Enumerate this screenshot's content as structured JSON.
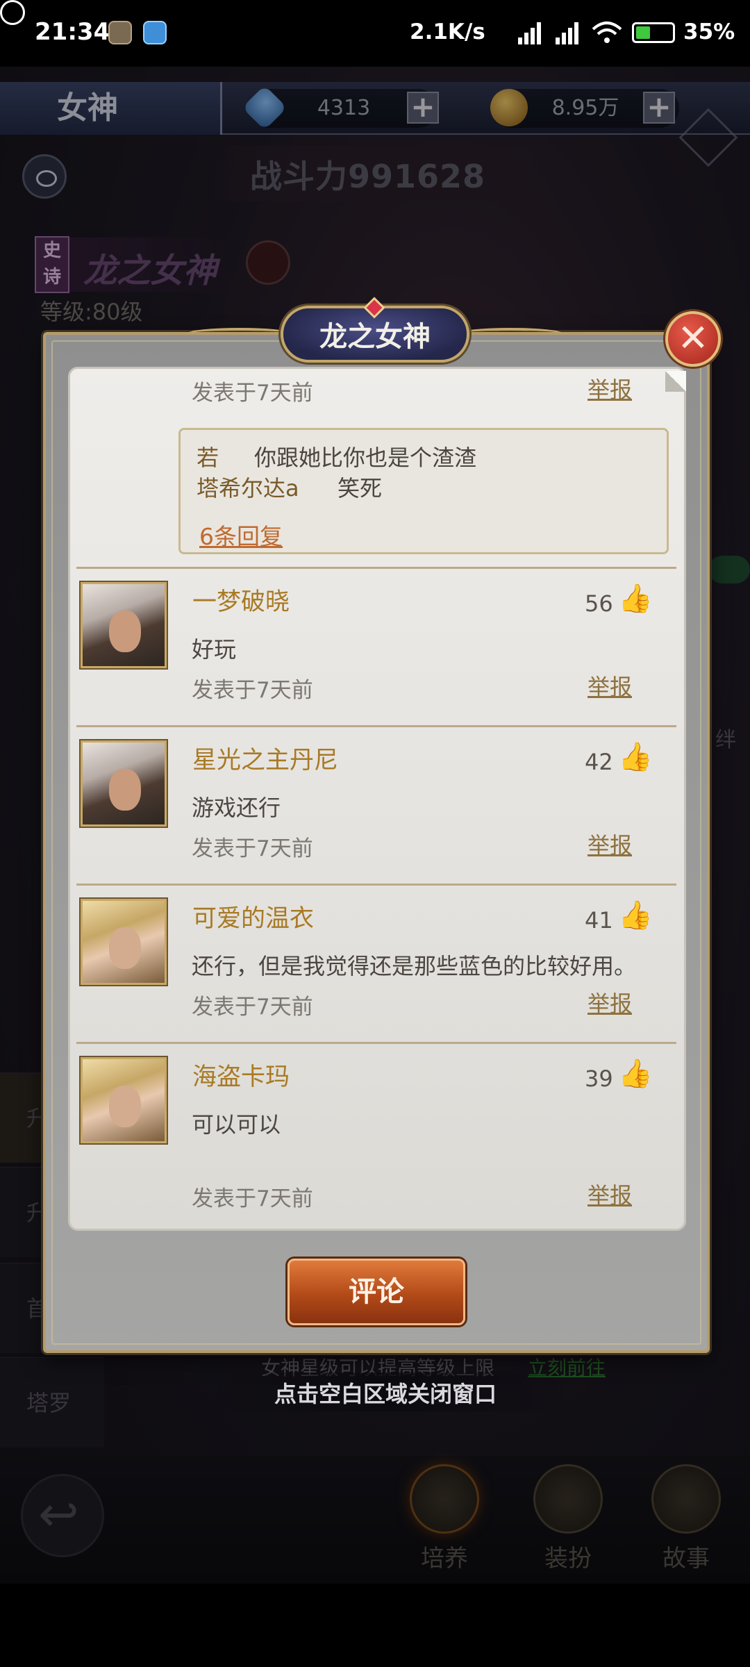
{
  "status_bar": {
    "time": "21:34",
    "network_speed": "2.1K/s",
    "battery": "35%"
  },
  "game": {
    "page_title": "女神",
    "gems": "4313",
    "gold": "8.95万",
    "combat_power": "战斗力991628",
    "hero": {
      "rarity": "史诗",
      "name": "龙之女神",
      "level": "等级:80级"
    },
    "side_tabs": [
      "升",
      "升",
      "首",
      "塔罗"
    ],
    "right_label": "绊",
    "star_hint": "女神星级可以提高等级上限",
    "star_hint_link": "立刻前往",
    "close_hint": "点击空白区域关闭窗口",
    "nav": {
      "cultivate": "培养",
      "dress": "装扮",
      "story": "故事"
    }
  },
  "modal": {
    "title": "龙之女神",
    "top_comment": {
      "date": "发表于7天前",
      "report": "举报",
      "replies": [
        {
          "user": "若",
          "text": "你跟她比你也是个渣渣"
        },
        {
          "user": "塔希尔达a",
          "text": "笑死"
        }
      ],
      "reply_count": "6条回复"
    },
    "comments": [
      {
        "name": "一梦破晓",
        "text": "好玩",
        "date": "发表于7天前",
        "likes": "56",
        "report": "举报"
      },
      {
        "name": "星光之主丹尼",
        "text": "游戏还行",
        "date": "发表于7天前",
        "likes": "42",
        "report": "举报"
      },
      {
        "name": "可爱的温衣",
        "text": "还行，但是我觉得还是那些蓝色的比较好用。",
        "date": "发表于7天前",
        "likes": "41",
        "report": "举报"
      },
      {
        "name": "海盗卡玛",
        "text": "可以可以",
        "date": "发表于7天前",
        "likes": "39",
        "report": "举报"
      }
    ],
    "comment_button": "评论"
  }
}
